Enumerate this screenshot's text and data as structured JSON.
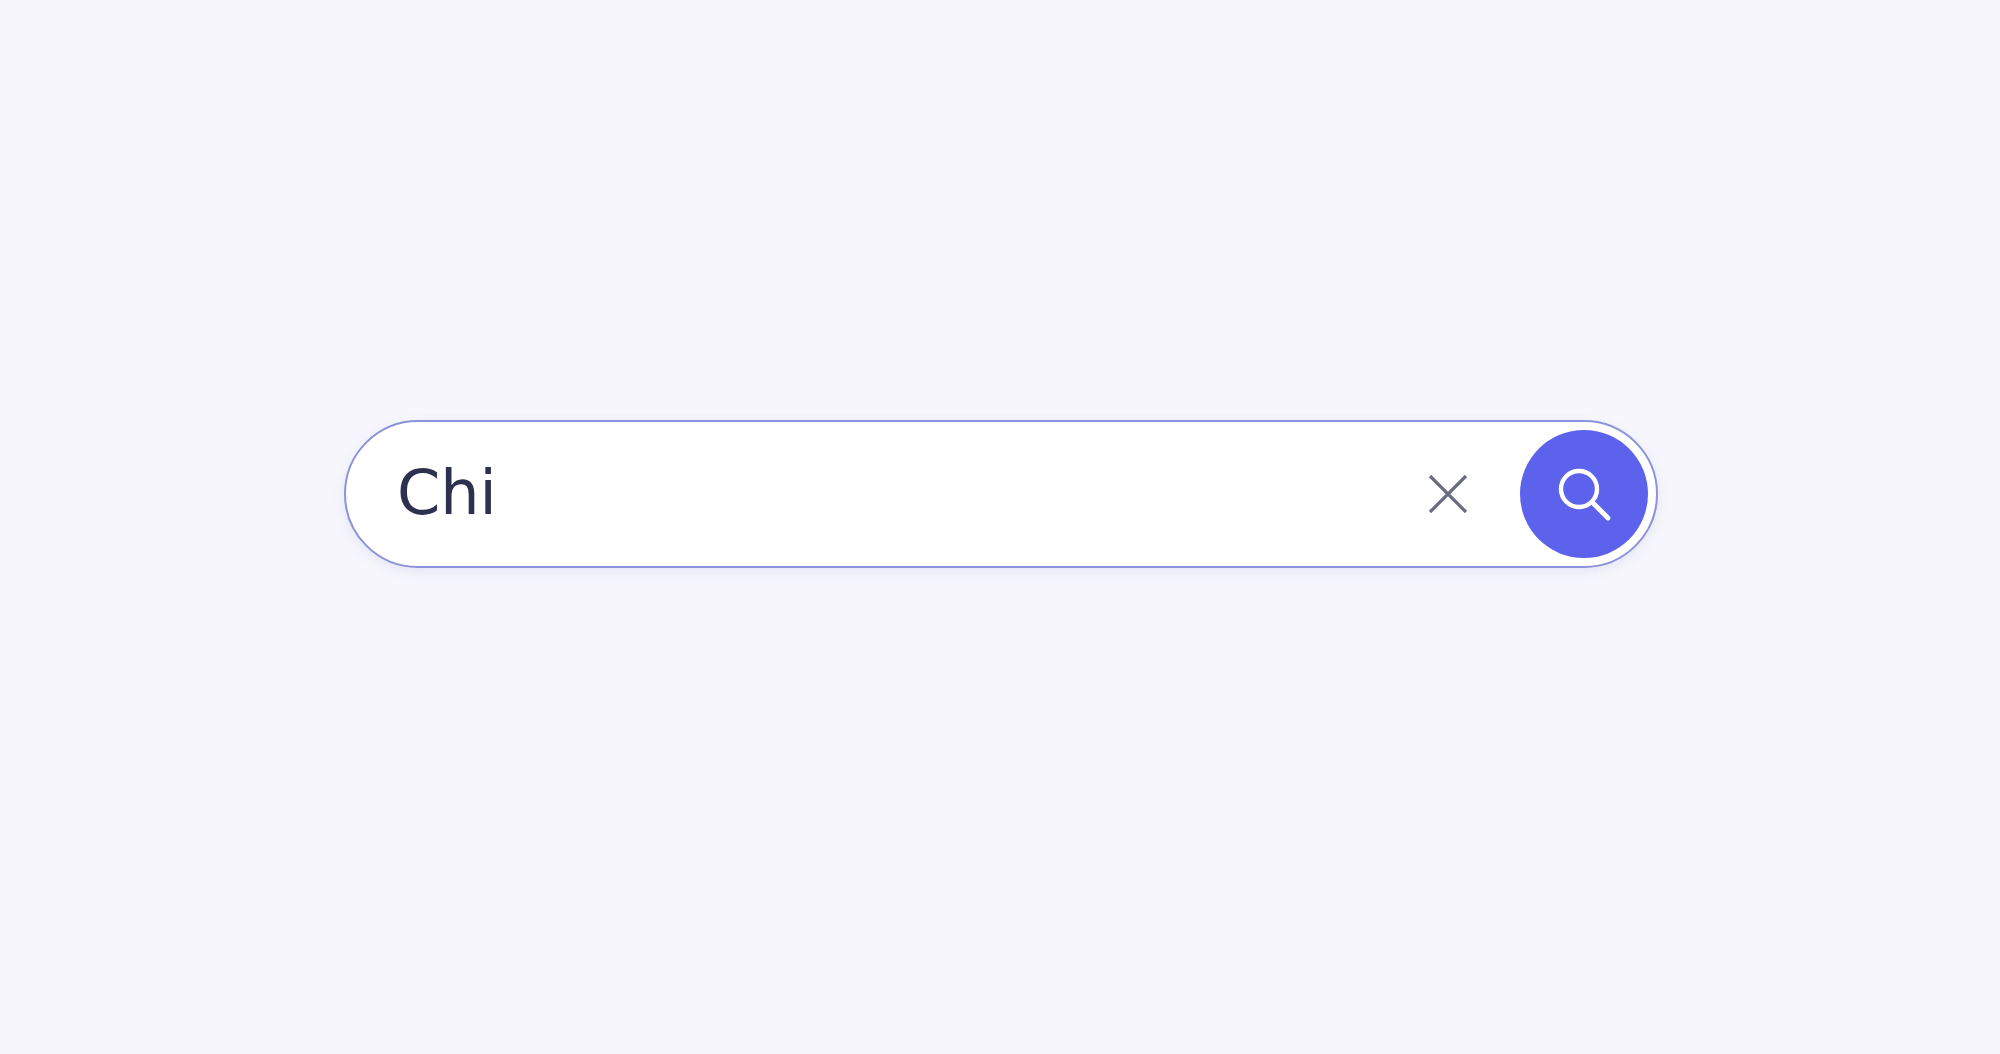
{
  "search": {
    "value": "Chi"
  }
}
